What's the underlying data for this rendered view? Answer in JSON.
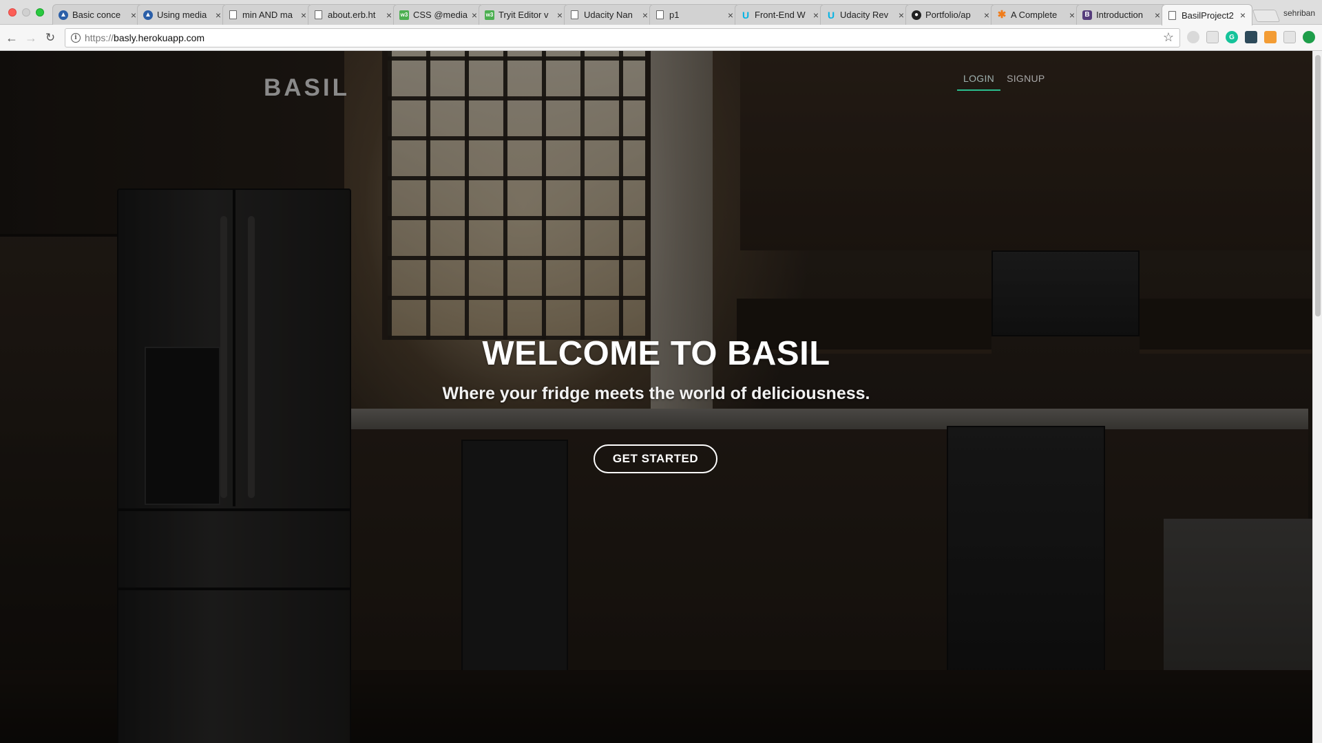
{
  "browser": {
    "tabs": [
      {
        "title": "Basic conce",
        "favicon": "mdn-icon"
      },
      {
        "title": "Using media",
        "favicon": "mdn-icon"
      },
      {
        "title": "min AND ma",
        "favicon": "document-icon"
      },
      {
        "title": "about.erb.ht",
        "favicon": "document-icon"
      },
      {
        "title": "CSS @media",
        "favicon": "w3schools-icon"
      },
      {
        "title": "Tryit Editor v",
        "favicon": "w3schools-icon"
      },
      {
        "title": "Udacity Nan",
        "favicon": "document-icon"
      },
      {
        "title": "p1",
        "favicon": "document-icon"
      },
      {
        "title": "Front-End W",
        "favicon": "udacity-icon"
      },
      {
        "title": "Udacity Rev",
        "favicon": "udacity-icon"
      },
      {
        "title": "Portfolio/ap",
        "favicon": "github-icon"
      },
      {
        "title": "A Complete",
        "favicon": "star-icon"
      },
      {
        "title": "Introduction",
        "favicon": "bootstrap-icon"
      },
      {
        "title": "BasilProject2",
        "favicon": "document-icon",
        "active": true
      }
    ],
    "profile_name": "sehriban",
    "url": {
      "scheme": "https://",
      "host": "basly.herokuapp.com"
    },
    "favicon_letters": {
      "w3schools": "w3",
      "bootstrap": "B",
      "udacity": "U",
      "star": "✱"
    }
  },
  "site": {
    "brand": "BASIL",
    "nav": {
      "login": "LOGIN",
      "signup": "SIGNUP"
    },
    "hero": {
      "title": "WELCOME TO BASIL",
      "subtitle": "Where your fridge meets the world of deliciousness.",
      "cta": "GET STARTED"
    },
    "colors": {
      "accent": "#2bbf8f",
      "brand": "#8a8a8a",
      "text": "#ffffff"
    }
  }
}
